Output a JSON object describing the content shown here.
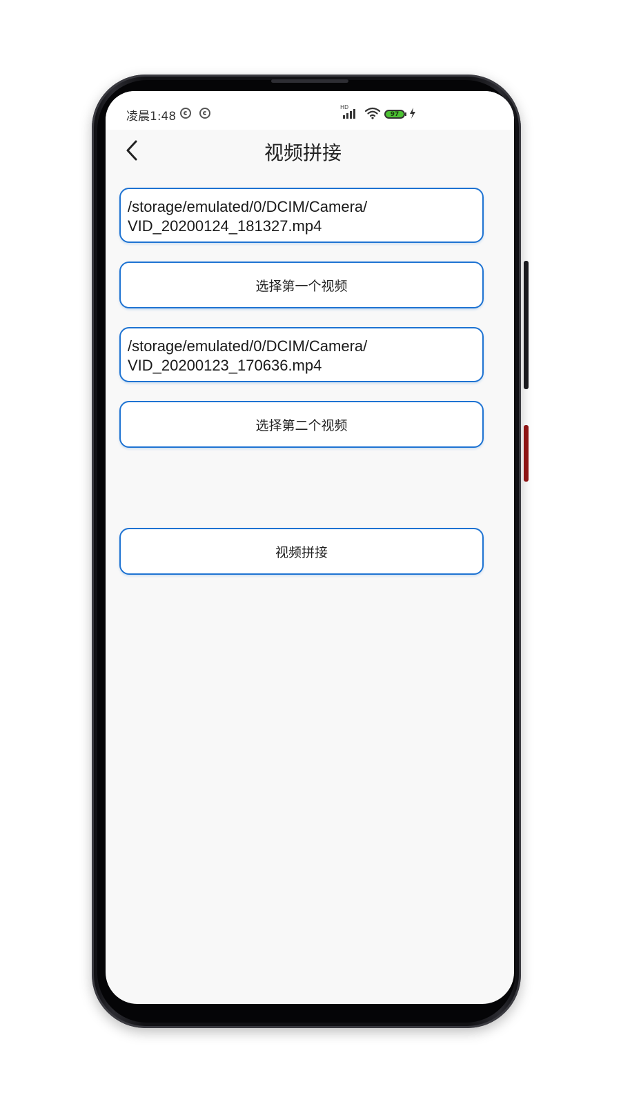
{
  "status_bar": {
    "time": "凌晨1:48",
    "network_label": "HD",
    "battery_level": "97"
  },
  "app_bar": {
    "title": "视频拼接"
  },
  "form": {
    "first_video_path_line1": "/storage/emulated/0/DCIM/Camera/",
    "first_video_path_line2": "VID_20200124_181327.mp4",
    "select_first_label": "选择第一个视频",
    "second_video_path_line1": "/storage/emulated/0/DCIM/Camera/",
    "second_video_path_line2": "VID_20200123_170636.mp4",
    "select_second_label": "选择第二个视频",
    "merge_label": "视频拼接"
  },
  "colors": {
    "accent": "#1e73d2",
    "battery": "#4cc232",
    "screen_bg": "#f8f8f8"
  }
}
